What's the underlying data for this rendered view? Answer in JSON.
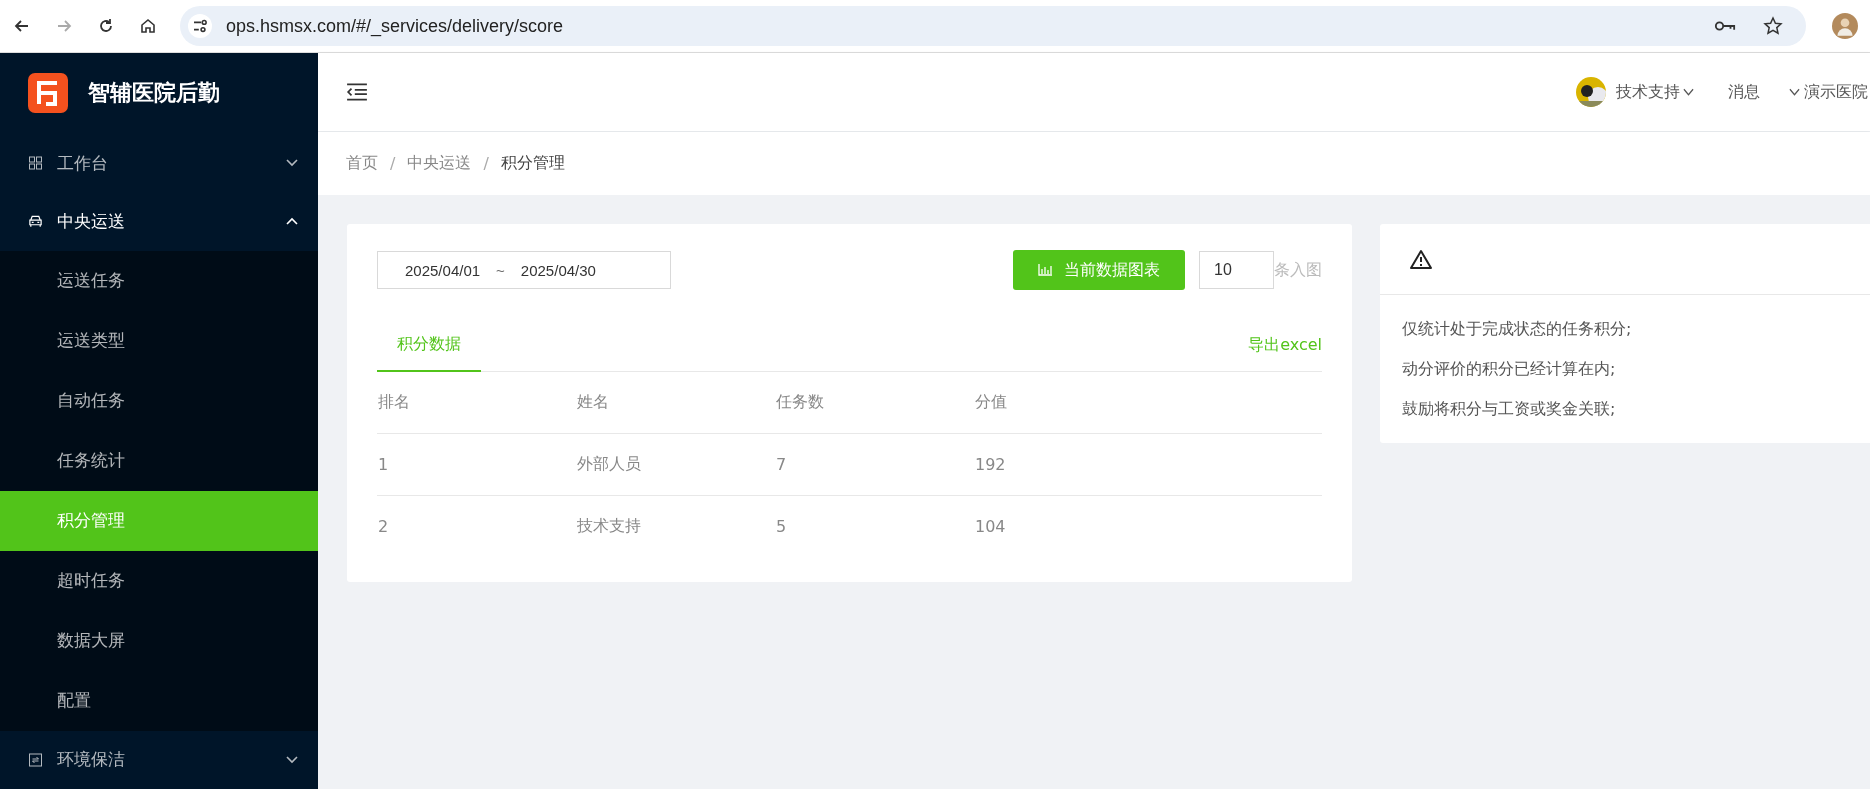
{
  "browser": {
    "url": "ops.hsmsx.com/#/_services/delivery/score"
  },
  "app": {
    "title": "智辅医院后勤"
  },
  "sidebar": {
    "items": [
      {
        "label": "工作台",
        "expanded": false
      },
      {
        "label": "中央运送",
        "expanded": true,
        "children": [
          {
            "label": "运送任务",
            "selected": false
          },
          {
            "label": "运送类型",
            "selected": false
          },
          {
            "label": "自动任务",
            "selected": false
          },
          {
            "label": "任务统计",
            "selected": false
          },
          {
            "label": "积分管理",
            "selected": true
          },
          {
            "label": "超时任务",
            "selected": false
          },
          {
            "label": "数据大屏",
            "selected": false
          },
          {
            "label": "配置",
            "selected": false
          }
        ]
      },
      {
        "label": "环境保洁",
        "expanded": false
      }
    ]
  },
  "header": {
    "user": "技术支持",
    "messages": "消息",
    "hospital": "演示医院"
  },
  "breadcrumb": [
    {
      "label": "首页"
    },
    {
      "separator": "/",
      "label": "中央运送"
    },
    {
      "separator": "/",
      "label": "积分管理"
    }
  ],
  "filter": {
    "date_start": "2025/04/01",
    "date_separator": "~",
    "date_end": "2025/04/30",
    "chart_button": "当前数据图表",
    "count": "10",
    "count_suffix": "条入图"
  },
  "tabs": [
    {
      "label": "积分数据",
      "selected": true
    }
  ],
  "export": "导出excel",
  "table": {
    "columns": [
      "排名",
      "姓名",
      "任务数",
      "分值"
    ],
    "rows": [
      [
        "1",
        "外部人员",
        "7",
        "192"
      ],
      [
        "2",
        "技术支持",
        "5",
        "104"
      ]
    ]
  },
  "notice": {
    "lines": [
      "仅统计处于完成状态的任务积分;",
      "动分评价的积分已经计算在内;",
      "鼓励将积分与工资或奖金关联;"
    ]
  }
}
